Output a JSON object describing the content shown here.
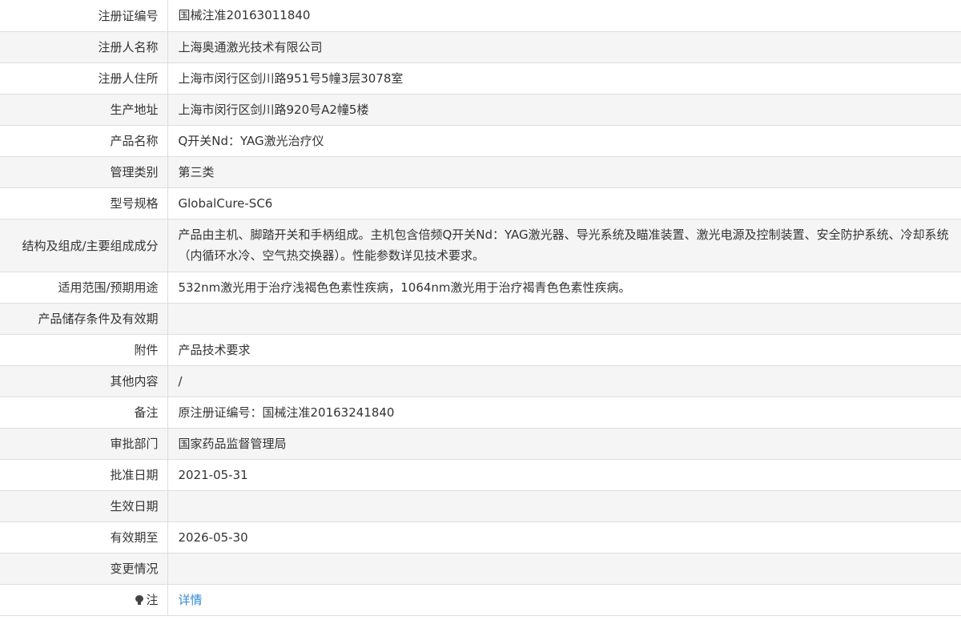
{
  "rows": [
    {
      "label": "注册证编号",
      "value": "国械注准20163011840"
    },
    {
      "label": "注册人名称",
      "value": "上海奥通激光技术有限公司"
    },
    {
      "label": "注册人住所",
      "value": "上海市闵行区剑川路951号5幢3层3078室"
    },
    {
      "label": "生产地址",
      "value": "上海市闵行区剑川路920号A2幢5楼"
    },
    {
      "label": "产品名称",
      "value": "Q开关Nd：YAG激光治疗仪"
    },
    {
      "label": "管理类别",
      "value": "第三类"
    },
    {
      "label": "型号规格",
      "value": "GlobalCure-SC6"
    },
    {
      "label": "结构及组成/主要组成成分",
      "value": "产品由主机、脚踏开关和手柄组成。主机包含倍频Q开关Nd：YAG激光器、导光系统及瞄准装置、激光电源及控制装置、安全防护系统、冷却系统（内循环水冷、空气热交换器）。性能参数详见技术要求。"
    },
    {
      "label": "适用范围/预期用途",
      "value": "532nm激光用于治疗浅褐色色素性疾病，1064nm激光用于治疗褐青色色素性疾病。"
    },
    {
      "label": "产品储存条件及有效期",
      "value": ""
    },
    {
      "label": "附件",
      "value": "产品技术要求"
    },
    {
      "label": "其他内容",
      "value": "/"
    },
    {
      "label": "备注",
      "value": "原注册证编号：国械注准20163241840"
    },
    {
      "label": "审批部门",
      "value": "国家药品监督管理局"
    },
    {
      "label": "批准日期",
      "value": "2021-05-31"
    },
    {
      "label": "生效日期",
      "value": ""
    },
    {
      "label": "有效期至",
      "value": "2026-05-30"
    },
    {
      "label": "变更情况",
      "value": ""
    }
  ],
  "note_row": {
    "label": "注",
    "icon": "lightbulb-icon",
    "link_text": "详情",
    "link_color": "#2f89d8"
  }
}
